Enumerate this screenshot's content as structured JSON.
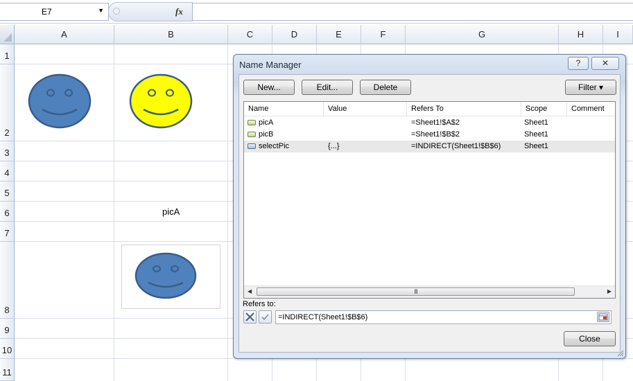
{
  "formula_bar": {
    "name_box": "E7",
    "fx_label": "fx",
    "formula": ""
  },
  "sheet": {
    "columns": [
      "A",
      "B",
      "C",
      "D",
      "E",
      "F",
      "G",
      "H",
      "I"
    ],
    "rows": [
      "1",
      "2",
      "3",
      "4",
      "5",
      "6",
      "7",
      "8",
      "9",
      "10",
      "11"
    ],
    "cell_B6": "picA"
  },
  "smileys": {
    "a2_color": "#4f81bd",
    "b2_color": "#ffff00",
    "b8_color": "#4f81bd"
  },
  "dialog": {
    "title": "Name Manager",
    "help_label": "?",
    "close_x_label": "✕",
    "buttons": {
      "new": "New...",
      "edit": "Edit...",
      "delete": "Delete",
      "filter": "Filter ▾",
      "close": "Close"
    },
    "columns": [
      "Name",
      "Value",
      "Refers To",
      "Scope",
      "Comment"
    ],
    "rows": [
      {
        "name": "picA",
        "value": "",
        "refers_to": "=Sheet1!$A$2",
        "scope": "Sheet1",
        "comment": "",
        "icon": "name-icon"
      },
      {
        "name": "picB",
        "value": "",
        "refers_to": "=Sheet1!$B$2",
        "scope": "Sheet1",
        "comment": "",
        "icon": "name-icon"
      },
      {
        "name": "selectPic",
        "value": "{...}",
        "refers_to": "=INDIRECT(Sheet1!$B$6)",
        "scope": "Sheet1",
        "comment": "",
        "icon": "name-icon-selected"
      }
    ],
    "refers_to_label": "Refers to:",
    "refers_to_value": "=INDIRECT(Sheet1!$B$6)",
    "scroll_grip": "III"
  }
}
